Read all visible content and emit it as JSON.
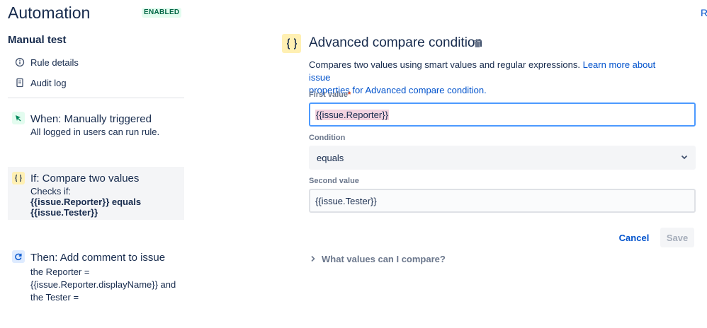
{
  "header": {
    "title": "Automation",
    "status_badge": "ENABLED",
    "edge_link": "R"
  },
  "sidebar": {
    "section_title": "Manual test",
    "menu": [
      {
        "label": "Rule details",
        "icon": "info-icon"
      },
      {
        "label": "Audit log",
        "icon": "document-icon"
      }
    ],
    "cards": [
      {
        "title": "When: Manually triggered",
        "desc_lines": [
          "All logged in users can run rule."
        ],
        "icon": "cursor-click-icon",
        "icon_bg": "#e3fcef",
        "icon_color": "#00875a"
      },
      {
        "title": "If: Compare two values",
        "desc_lines": [
          "Checks if:",
          "{{issue.Reporter}} equals",
          "{{issue.Tester}}"
        ],
        "icon": "curly-braces-icon",
        "icon_bg": "#fff0b3",
        "icon_color": "#172b4d",
        "selected": true
      },
      {
        "title": "Then: Add comment to issue",
        "desc_lines": [
          "the Reporter =",
          "{{issue.Reporter.displayName}} and",
          "the Tester ="
        ],
        "icon": "refresh-icon",
        "icon_bg": "#deebff",
        "icon_color": "#0052cc"
      }
    ]
  },
  "main": {
    "title": "Advanced compare condition",
    "description": "Compares two values using smart values and regular expressions.",
    "learn_more_line1": "Learn more about issue",
    "learn_more_line2": "properties for Advanced compare condition.",
    "first_value_label": "First value",
    "required_marker": "*",
    "first_value": "{{issue.Reporter}}",
    "condition_label": "Condition",
    "condition_value": "equals",
    "second_value_label": "Second value",
    "second_value": "{{issue.Tester}}",
    "cancel_label": "Cancel",
    "save_label": "Save",
    "help_toggle": "What values can I compare?"
  },
  "colors": {
    "link": "#0052cc",
    "text": "#172b4d",
    "muted": "#6b778c",
    "focus_border": "#4c9aff",
    "enabled_green": "#006644"
  }
}
